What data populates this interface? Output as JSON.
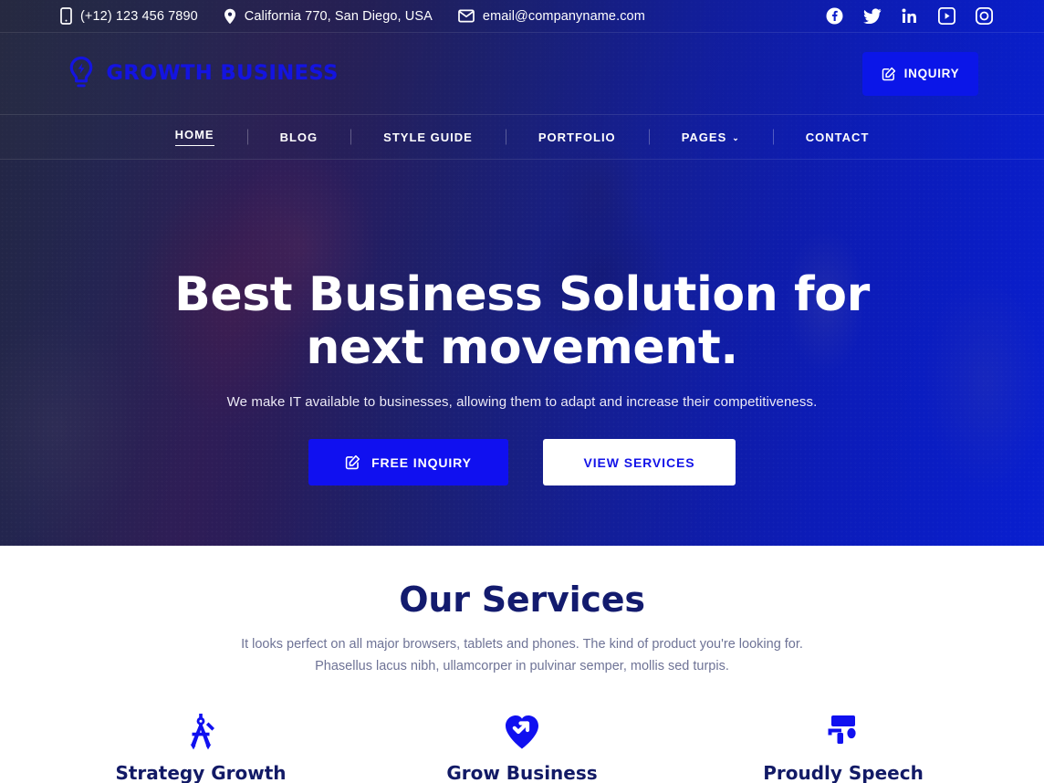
{
  "topbar": {
    "contacts": [
      {
        "icon": "phone-icon",
        "text": "(+12) 123 456 7890"
      },
      {
        "icon": "location-pin-icon",
        "text": "California 770, San Diego, USA"
      },
      {
        "icon": "envelope-icon",
        "text": "email@companyname.com"
      }
    ],
    "social": [
      {
        "name": "facebook-icon"
      },
      {
        "name": "twitter-icon"
      },
      {
        "name": "linkedin-icon"
      },
      {
        "name": "youtube-icon"
      },
      {
        "name": "instagram-icon"
      }
    ]
  },
  "header": {
    "logo_text": "GROWTH BUSINESS",
    "logo_icon": "lightbulb-bolt-icon",
    "inquiry_label": "INQUIRY",
    "inquiry_icon": "edit-square-icon"
  },
  "nav": {
    "items": [
      {
        "label": "HOME",
        "active": true,
        "has_caret": false
      },
      {
        "label": "BLOG",
        "active": false,
        "has_caret": false
      },
      {
        "label": "STYLE GUIDE",
        "active": false,
        "has_caret": false
      },
      {
        "label": "PORTFOLIO",
        "active": false,
        "has_caret": false
      },
      {
        "label": "PAGES",
        "active": false,
        "has_caret": true
      },
      {
        "label": "CONTACT",
        "active": false,
        "has_caret": false
      }
    ],
    "caret_glyph": "⌄"
  },
  "hero": {
    "title": "Best Business Solution for next movement.",
    "subtitle": "We make IT available to businesses, allowing them to adapt and increase their competitiveness.",
    "primary_cta": "FREE INQUIRY",
    "primary_cta_icon": "edit-square-icon",
    "secondary_cta": "VIEW SERVICES"
  },
  "services": {
    "title": "Our Services",
    "description": "It looks perfect on all major browsers, tablets and phones. The kind of product you're looking for. Phasellus lacus nibh, ullamcorper in pulvinar semper, mollis sed turpis.",
    "cards": [
      {
        "title": "Strategy Growth",
        "icon": "drafting-compass-icon"
      },
      {
        "title": "Grow Business",
        "icon": "heart-arrow-icon"
      },
      {
        "title": "Proudly Speech",
        "icon": "paint-roller-icon"
      }
    ]
  },
  "colors": {
    "brand_blue": "#1414e8",
    "button_blue": "#0b16e8",
    "heading_navy": "#131b6e",
    "body_text": "#6e7396",
    "white": "#ffffff"
  }
}
